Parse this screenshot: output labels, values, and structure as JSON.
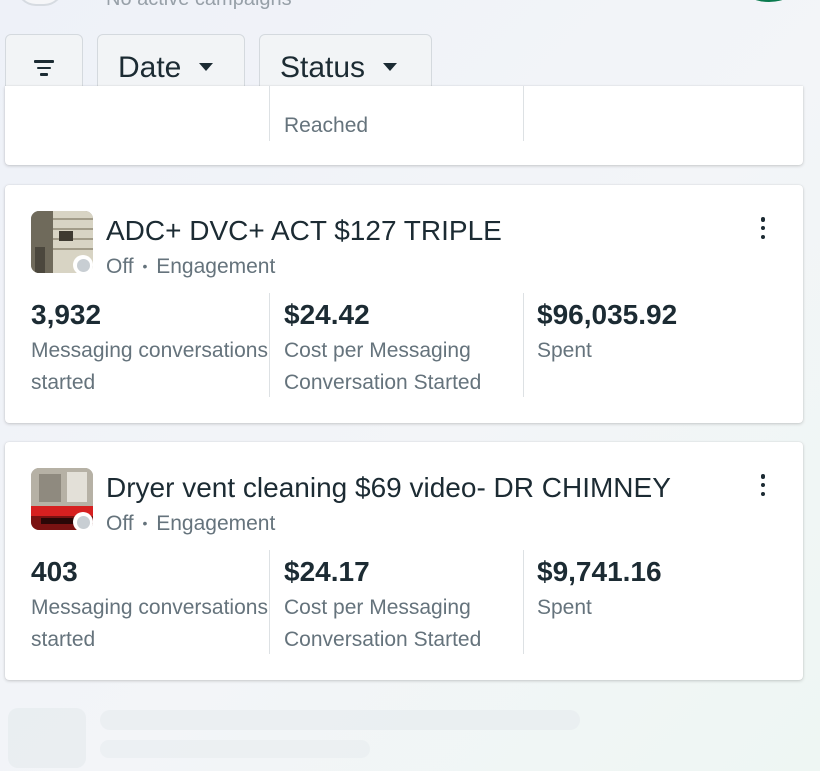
{
  "header": {
    "subtext": "No active campaigns"
  },
  "filters": {
    "filter_icon": "filter-icon",
    "date_label": "Date",
    "status_label": "Status"
  },
  "partial_card": {
    "label": "Reached"
  },
  "campaigns": [
    {
      "name": "ADC+ DVC+ ACT $127 TRIPLE",
      "status": "Off",
      "separator": "•",
      "objective": "Engagement",
      "metrics": [
        {
          "value": "3,932",
          "label": "Messaging conversations started"
        },
        {
          "value": "$24.42",
          "label": "Cost per Messaging Conversation Started"
        },
        {
          "value": "$96,035.92",
          "label": "Spent"
        }
      ]
    },
    {
      "name": "Dryer vent cleaning $69 video- DR CHIMNEY",
      "status": "Off",
      "separator": "•",
      "objective": "Engagement",
      "metrics": [
        {
          "value": "403",
          "label": "Messaging conversations started"
        },
        {
          "value": "$24.17",
          "label": "Cost per Messaging Conversation Started"
        },
        {
          "value": "$9,741.16",
          "label": "Spent"
        }
      ]
    }
  ],
  "colors": {
    "text_primary": "#1c2b33",
    "text_secondary": "#65737c",
    "status_off": "#c8ced3",
    "profile_green": "#0a7a4e"
  }
}
